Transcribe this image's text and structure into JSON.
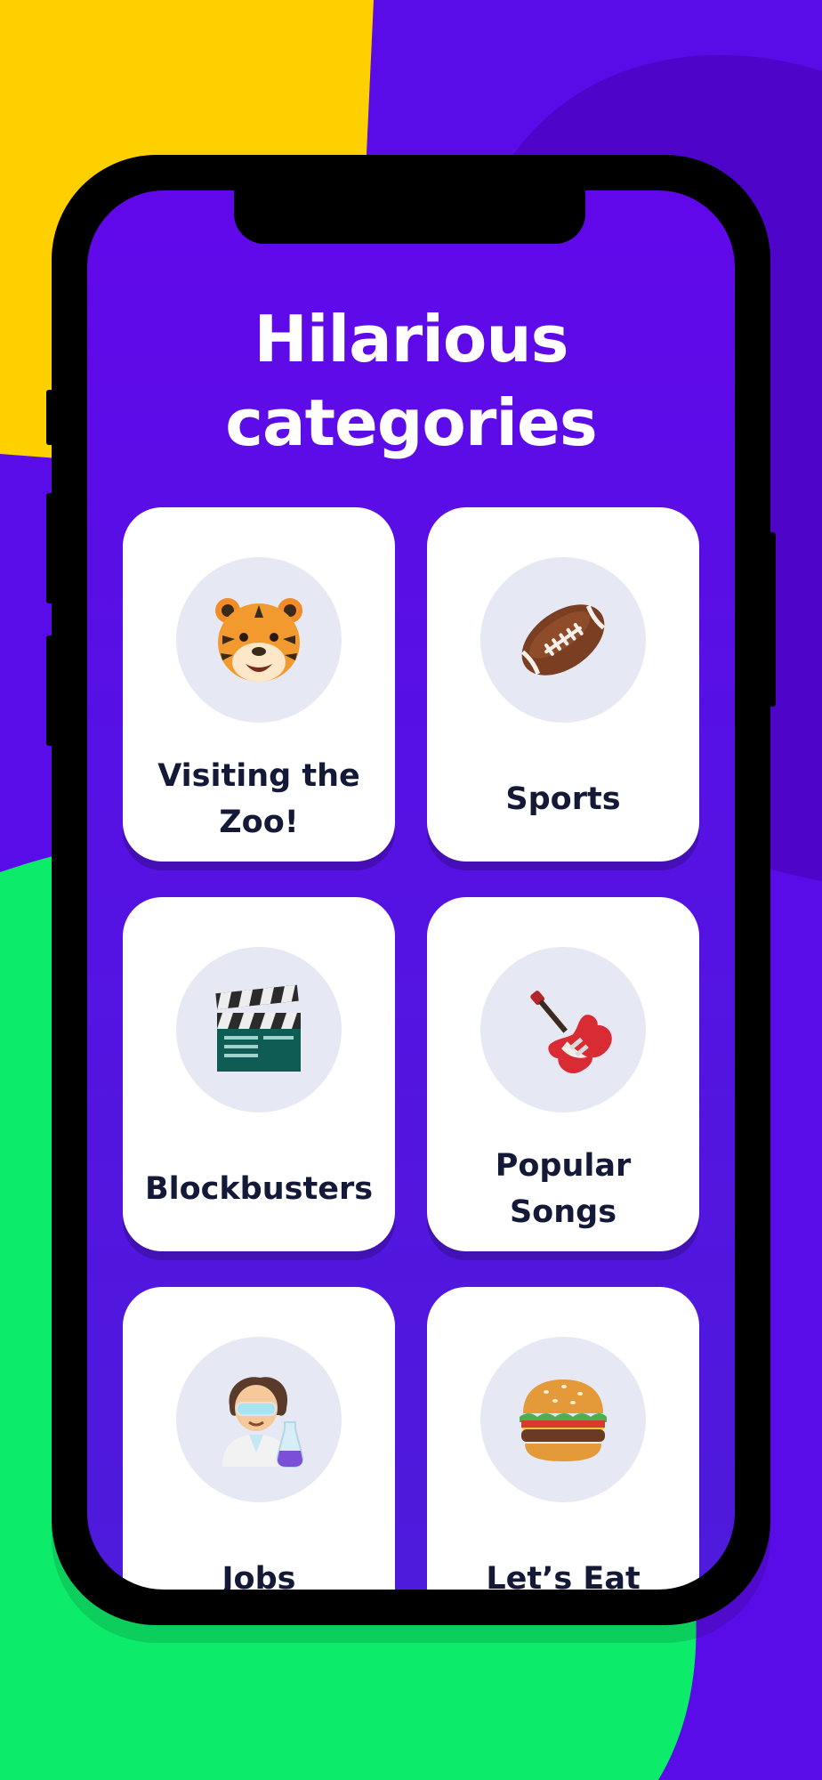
{
  "screen": {
    "headline_line1": "Hilarious",
    "headline_line2": "categories"
  },
  "categories": [
    {
      "label_line1": "Visiting the",
      "label_line2": "Zoo!",
      "icon": "tiger-face-icon"
    },
    {
      "label_line1": "Sports",
      "label_line2": "",
      "icon": "american-football-icon"
    },
    {
      "label_line1": "Blockbusters",
      "label_line2": "",
      "icon": "clapper-board-icon"
    },
    {
      "label_line1": "Popular",
      "label_line2": "Songs",
      "icon": "electric-guitar-icon"
    },
    {
      "label_line1": "Jobs",
      "label_line2": "",
      "icon": "scientist-icon"
    },
    {
      "label_line1": "Let’s Eat",
      "label_line2": "",
      "icon": "hamburger-icon"
    }
  ],
  "colors": {
    "screen_purple": "#5A0CE8",
    "yellow": "#FFD000",
    "green": "#0DEB6A",
    "card": "#FFFFFF",
    "label": "#141938",
    "icon_circle": "#E6E9F4"
  }
}
